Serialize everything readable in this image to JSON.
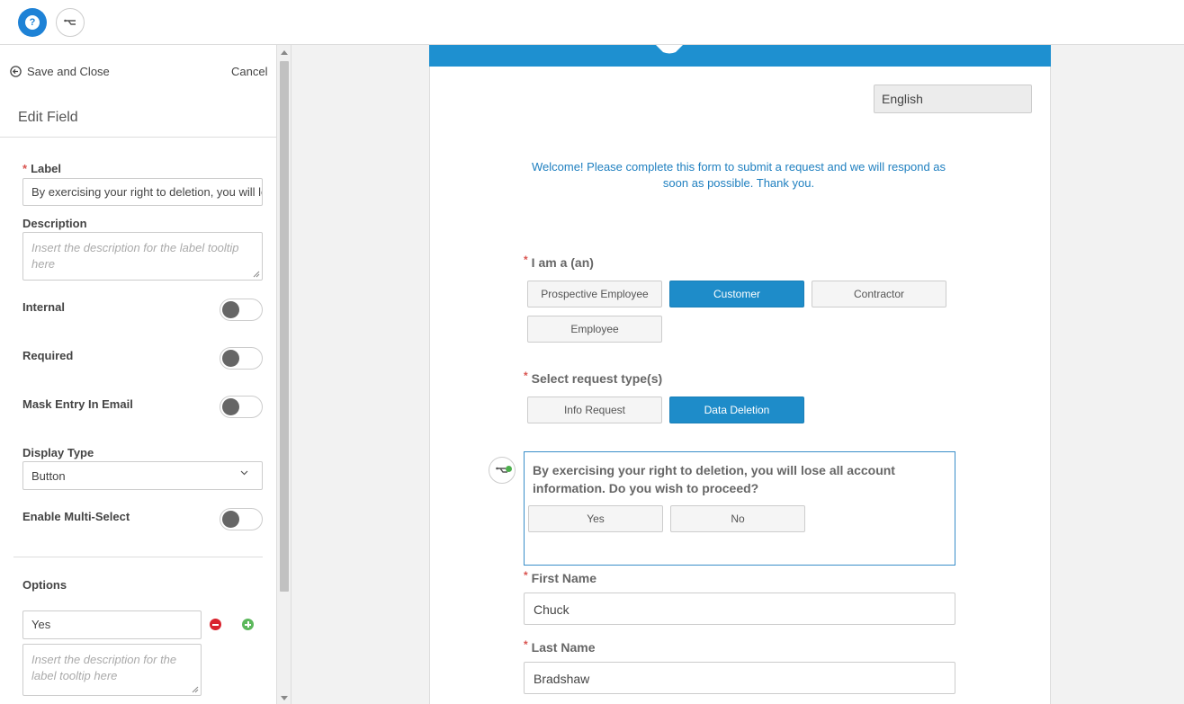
{
  "toolbar": {
    "help_icon": "question-circle-icon",
    "flow_icon": "branch-icon"
  },
  "left_panel": {
    "save_close_label": "Save and Close",
    "cancel_label": "Cancel",
    "title": "Edit Field",
    "label_field": {
      "label": "Label",
      "required_mark": "*",
      "value": "By exercising your right to deletion, you will lose all account information. Do you wish to proceed?"
    },
    "description_field": {
      "label": "Description",
      "placeholder": "Insert the description for the label tooltip here"
    },
    "toggles": [
      {
        "label": "Internal",
        "on": false
      },
      {
        "label": "Required",
        "on": false
      },
      {
        "label": "Mask Entry In Email",
        "on": false
      }
    ],
    "display_type": {
      "label": "Display Type",
      "value": "Button"
    },
    "multi_select": {
      "label": "Enable Multi-Select",
      "on": false
    },
    "options": {
      "label": "Options",
      "items": [
        {
          "value": "Yes",
          "description_placeholder": "Insert the description for the label tooltip here"
        }
      ]
    }
  },
  "form": {
    "language": "English",
    "welcome": "Welcome! Please complete this form to submit a request and we will respond as soon as possible. Thank you.",
    "required_mark": "*",
    "q_role": {
      "label": "I am a (an)",
      "options": [
        "Prospective Employee",
        "Customer",
        "Contractor",
        "Employee"
      ],
      "selected": "Customer"
    },
    "q_request": {
      "label": "Select request type(s)",
      "options": [
        "Info Request",
        "Data Deletion"
      ],
      "selected": "Data Deletion"
    },
    "q_confirm": {
      "label": "By exercising your right to deletion, you will lose all account information. Do you wish to proceed?",
      "options": [
        "Yes",
        "No"
      ]
    },
    "first_name": {
      "label": "First Name",
      "value": "Chuck"
    },
    "last_name": {
      "label": "Last Name",
      "value": "Bradshaw"
    }
  },
  "colors": {
    "accent": "#1e8cc9",
    "required": "#d9534f",
    "welcome_text": "#2080c0"
  }
}
